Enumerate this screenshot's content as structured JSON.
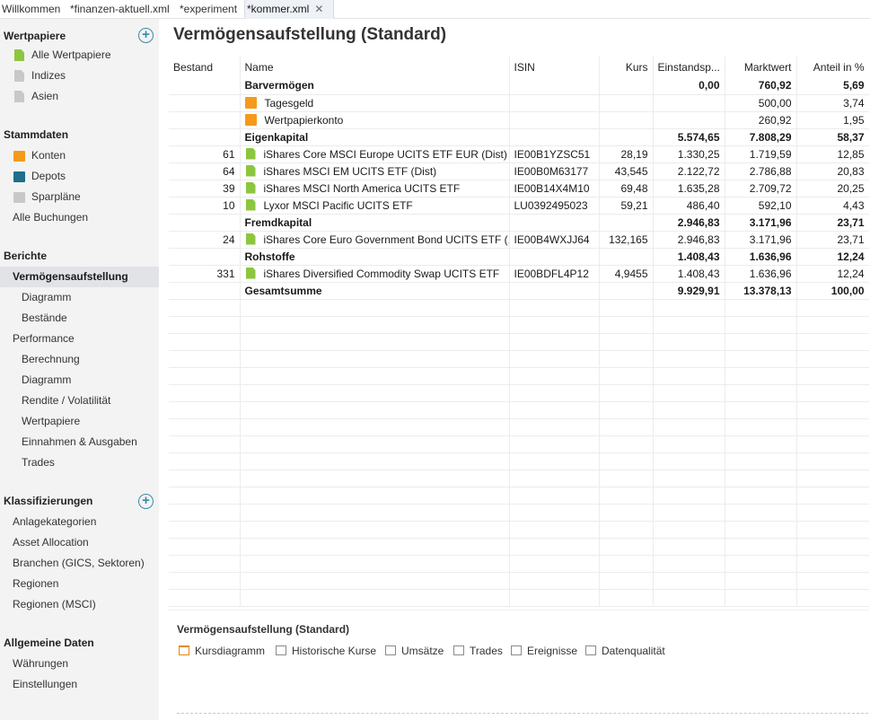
{
  "tabs": [
    {
      "label": "Willkommen"
    },
    {
      "label": "*finanzen-aktuell.xml"
    },
    {
      "label": "*experiment"
    },
    {
      "label": "*kommer.xml"
    }
  ],
  "sidebar": {
    "wertpapiere": {
      "title": "Wertpapiere",
      "items": [
        "Alle Wertpapiere",
        "Indizes",
        "Asien"
      ]
    },
    "stammdaten": {
      "title": "Stammdaten",
      "items": [
        "Konten",
        "Depots",
        "Sparpläne",
        "Alle Buchungen"
      ]
    },
    "berichte": {
      "title": "Berichte",
      "items": [
        "Vermögensaufstellung",
        "Diagramm",
        "Bestände",
        "Performance",
        "Berechnung",
        "Diagramm",
        "Rendite / Volatilität",
        "Wertpapiere",
        "Einnahmen & Ausgaben",
        "Trades"
      ]
    },
    "klassifizierungen": {
      "title": "Klassifizierungen",
      "items": [
        "Anlagekategorien",
        "Asset Allocation",
        "Branchen (GICS, Sektoren)",
        "Regionen",
        "Regionen (MSCI)"
      ]
    },
    "allgemein": {
      "title": "Allgemeine Daten",
      "items": [
        "Währungen",
        "Einstellungen"
      ]
    }
  },
  "main": {
    "title": "Vermögensaufstellung (Standard)",
    "columns": [
      "Bestand",
      "Name",
      "ISIN",
      "Kurs",
      "Einstandsp...",
      "Marktwert",
      "Anteil in %"
    ],
    "rows": [
      {
        "bestand": "",
        "name": "Barvermögen",
        "isin": "",
        "kurs": "",
        "einstand": "0,00",
        "marktwert": "760,92",
        "anteil": "5,69",
        "bold": true,
        "icon": "none"
      },
      {
        "bestand": "",
        "name": "Tagesgeld",
        "isin": "",
        "kurs": "",
        "einstand": "",
        "marktwert": "500,00",
        "anteil": "3,74",
        "bold": false,
        "icon": "folder"
      },
      {
        "bestand": "",
        "name": "Wertpapierkonto",
        "isin": "",
        "kurs": "",
        "einstand": "",
        "marktwert": "260,92",
        "anteil": "1,95",
        "bold": false,
        "icon": "folder"
      },
      {
        "bestand": "",
        "name": "Eigenkapital",
        "isin": "",
        "kurs": "",
        "einstand": "5.574,65",
        "marktwert": "7.808,29",
        "anteil": "58,37",
        "bold": true,
        "icon": "none"
      },
      {
        "bestand": "61",
        "name": "iShares Core MSCI Europe UCITS ETF EUR (Dist)",
        "isin": "IE00B1YZSC51",
        "kurs": "28,19",
        "einstand": "1.330,25",
        "marktwert": "1.719,59",
        "anteil": "12,85",
        "bold": false,
        "icon": "doc"
      },
      {
        "bestand": "64",
        "name": "iShares MSCI EM UCITS ETF (Dist)",
        "isin": "IE00B0M63177",
        "kurs": "43,545",
        "einstand": "2.122,72",
        "marktwert": "2.786,88",
        "anteil": "20,83",
        "bold": false,
        "icon": "doc"
      },
      {
        "bestand": "39",
        "name": "iShares MSCI North America UCITS ETF",
        "isin": "IE00B14X4M10",
        "kurs": "69,48",
        "einstand": "1.635,28",
        "marktwert": "2.709,72",
        "anteil": "20,25",
        "bold": false,
        "icon": "doc"
      },
      {
        "bestand": "10",
        "name": "Lyxor MSCI Pacific UCITS ETF",
        "isin": "LU0392495023",
        "kurs": "59,21",
        "einstand": "486,40",
        "marktwert": "592,10",
        "anteil": "4,43",
        "bold": false,
        "icon": "doc"
      },
      {
        "bestand": "",
        "name": "Fremdkapital",
        "isin": "",
        "kurs": "",
        "einstand": "2.946,83",
        "marktwert": "3.171,96",
        "anteil": "23,71",
        "bold": true,
        "icon": "none"
      },
      {
        "bestand": "24",
        "name": "iShares Core Euro Government Bond UCITS ETF (...",
        "isin": "IE00B4WXJJ64",
        "kurs": "132,165",
        "einstand": "2.946,83",
        "marktwert": "3.171,96",
        "anteil": "23,71",
        "bold": false,
        "icon": "doc"
      },
      {
        "bestand": "",
        "name": "Rohstoffe",
        "isin": "",
        "kurs": "",
        "einstand": "1.408,43",
        "marktwert": "1.636,96",
        "anteil": "12,24",
        "bold": true,
        "icon": "none"
      },
      {
        "bestand": "331",
        "name": "iShares Diversified Commodity Swap UCITS ETF",
        "isin": "IE00BDFL4P12",
        "kurs": "4,9455",
        "einstand": "1.408,43",
        "marktwert": "1.636,96",
        "anteil": "12,24",
        "bold": false,
        "icon": "doc"
      },
      {
        "bestand": "",
        "name": "Gesamtsumme",
        "isin": "",
        "kurs": "",
        "einstand": "9.929,91",
        "marktwert": "13.378,13",
        "anteil": "100,00",
        "bold": true,
        "icon": "none"
      }
    ]
  },
  "detail": {
    "title": "Vermögensaufstellung (Standard)",
    "tabs": [
      "Kursdiagramm",
      "Historische Kurse",
      "Umsätze",
      "Trades",
      "Ereignisse",
      "Datenqualität"
    ]
  },
  "colors": {
    "accent_orange": "#f59a1a",
    "security_green": "#8cc63f",
    "depot_blue": "#1f6e8c",
    "plus_teal": "#3a8aa8"
  }
}
